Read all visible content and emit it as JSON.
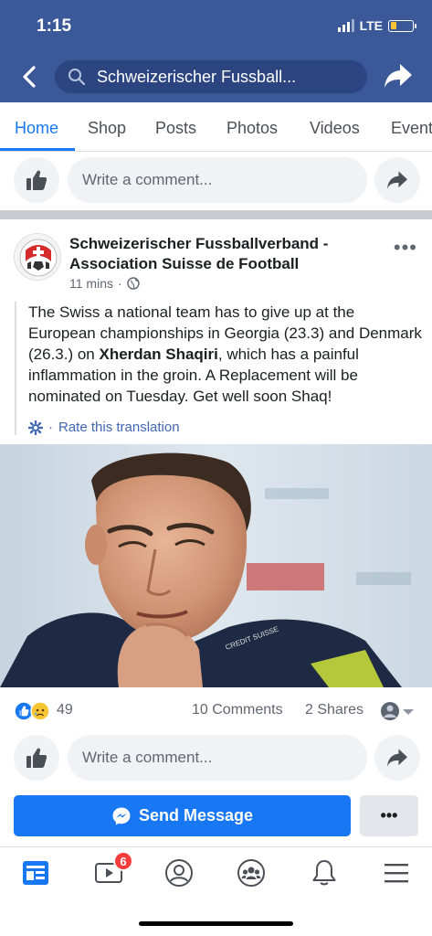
{
  "status_bar": {
    "time": "1:15",
    "network": "LTE"
  },
  "header": {
    "search_text": "Schweizerischer Fussball..."
  },
  "tabs": [
    {
      "label": "Home",
      "active": true
    },
    {
      "label": "Shop",
      "active": false
    },
    {
      "label": "Posts",
      "active": false
    },
    {
      "label": "Photos",
      "active": false
    },
    {
      "label": "Videos",
      "active": false
    },
    {
      "label": "Events",
      "active": false
    }
  ],
  "top_comment": {
    "placeholder": "Write a comment..."
  },
  "post": {
    "page_name": "Schweizerischer Fussballverband - Association Suisse de Football",
    "time": "11 mins",
    "text_before": "The Swiss a national team has to give up at the European championships in Georgia (23.3) and Denmark (26.3.) on ",
    "text_bold": "Xherdan Shaqiri",
    "text_after": ", which has a painful inflammation in the groin. A Replacement will be nominated on Tuesday. Get well soon Shaq!",
    "translate_label": "Rate this translation",
    "reaction_count": "49",
    "comments_label": "10 Comments",
    "shares_label": "2 Shares"
  },
  "bottom_comment": {
    "placeholder": "Write a comment..."
  },
  "send_message": {
    "label": "Send Message",
    "more": "•••"
  },
  "bottom_nav": {
    "video_badge": "6"
  },
  "colors": {
    "brand": "#3b5998",
    "accent": "#1877f2",
    "badge": "#fa3e3e"
  }
}
